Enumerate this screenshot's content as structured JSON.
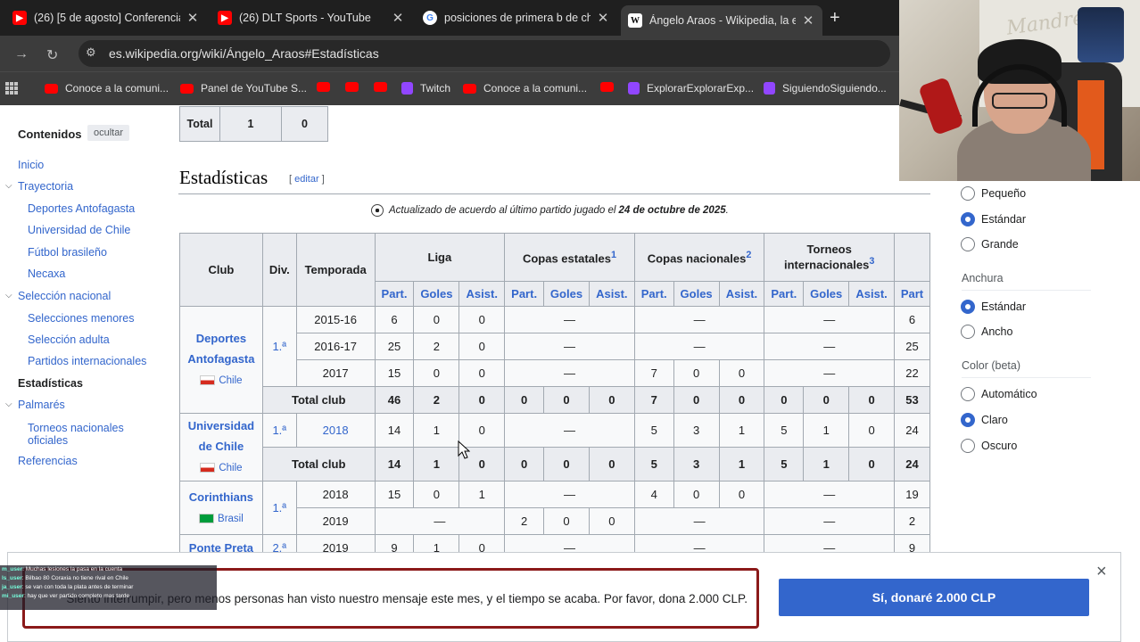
{
  "browser": {
    "tabs": [
      {
        "title": "(26) [5 de agosto] Conferencia",
        "icon": "youtube-icon"
      },
      {
        "title": "(26) DLT Sports - YouTube",
        "icon": "youtube-icon"
      },
      {
        "title": "posiciones de primera b de chi",
        "icon": "google-icon"
      },
      {
        "title": "Ángelo Araos - Wikipedia, la en",
        "icon": "wikipedia-icon"
      }
    ],
    "url": "es.wikipedia.org/wiki/Ángelo_Araos#Estadísticas",
    "bookmarks": [
      {
        "label": "Conoce a la comuni...",
        "icon": "youtube-icon"
      },
      {
        "label": "Panel de YouTube S...",
        "icon": "youtube-icon"
      },
      {
        "label": "",
        "icon": "youtube-icon"
      },
      {
        "label": "",
        "icon": "youtube-icon"
      },
      {
        "label": "",
        "icon": "youtube-icon"
      },
      {
        "label": "Twitch",
        "icon": "twitch-icon"
      },
      {
        "label": "Conoce a la comuni...",
        "icon": "twitch-icon"
      },
      {
        "label": "",
        "icon": "youtube-icon"
      },
      {
        "label": "ExplorarExplorarExp...",
        "icon": "twitch-icon"
      },
      {
        "label": "SiguiendoSiguiendo...",
        "icon": "twitch-icon"
      }
    ]
  },
  "toc": {
    "heading": "Contenidos",
    "hide_label": "ocultar",
    "items": [
      "Inicio",
      "Trayectoria",
      "Deportes Antofagasta",
      "Universidad de Chile",
      "Fútbol brasileño",
      "Necaxa",
      "Selección nacional",
      "Selecciones menores",
      "Selección adulta",
      "Partidos internacionales",
      "Estadísticas",
      "Palmarés",
      "Torneos nacionales oficiales",
      "Referencias"
    ]
  },
  "prev_table": {
    "label": "Total",
    "v1": "1",
    "v2": "0"
  },
  "section": {
    "title": "Estadísticas",
    "edit": "editar"
  },
  "updated": {
    "text": "Actualizado de acuerdo al último partido jugado el ",
    "date": "24 de octubre de 2025",
    "end": "."
  },
  "stats": {
    "headers": {
      "club": "Club",
      "div": "Div.",
      "season": "Temporada",
      "league": "Liga",
      "state_cups": "Copas estatales",
      "state_cups_note": "1",
      "national_cups": "Copas nacionales",
      "national_cups_note": "2",
      "intl": "Torneos internacionales",
      "intl_note": "3",
      "part": "Part.",
      "goals": "Goles",
      "assists": "Asist.",
      "part_cut": "Part"
    },
    "dash": "—",
    "total_club": "Total club",
    "clubs": [
      {
        "name": "Deportes Antofagasta",
        "country": "Chile",
        "div": "1.ª",
        "rows": [
          {
            "season": "2015-16",
            "lp": "6",
            "lg": "0",
            "la": "0",
            "np": "",
            "ng": "",
            "na": "",
            "last": "6"
          },
          {
            "season": "2016-17",
            "lp": "25",
            "lg": "2",
            "la": "0",
            "np": "",
            "ng": "",
            "na": "",
            "last": "25"
          },
          {
            "season": "2017",
            "lp": "15",
            "lg": "0",
            "la": "0",
            "np": "7",
            "ng": "0",
            "na": "0",
            "last": "22"
          }
        ],
        "total": [
          "46",
          "2",
          "0",
          "0",
          "0",
          "0",
          "7",
          "0",
          "0",
          "0",
          "0",
          "0",
          "53"
        ]
      },
      {
        "name": "Universidad de Chile",
        "country": "Chile",
        "div": "1.ª",
        "rows": [
          {
            "season": "2018",
            "lp": "14",
            "lg": "1",
            "la": "0",
            "np": "5",
            "ng": "3",
            "na": "1",
            "ip": "5",
            "ig": "1",
            "ia": "0",
            "last": "24"
          }
        ],
        "total": [
          "14",
          "1",
          "0",
          "0",
          "0",
          "0",
          "5",
          "3",
          "1",
          "5",
          "1",
          "0",
          "24"
        ]
      },
      {
        "name": "Corinthians",
        "country": "Brasil",
        "div": "1.ª",
        "rows": [
          {
            "season": "2018",
            "lp": "15",
            "lg": "0",
            "la": "1",
            "np": "4",
            "ng": "0",
            "na": "0",
            "last": "19"
          },
          {
            "season": "2019",
            "sp": "2",
            "sg": "0",
            "sa": "0",
            "last": "2"
          }
        ]
      },
      {
        "name": "Ponte Preta",
        "div": "2.ª",
        "rows": [
          {
            "season": "2019",
            "lp": "9",
            "lg": "1",
            "la": "0",
            "last": "9"
          }
        ]
      }
    ]
  },
  "appearance": {
    "text_options": [
      "Pequeño",
      "Estándar",
      "Grande"
    ],
    "width_heading": "Anchura",
    "width_options": [
      "Estándar",
      "Ancho"
    ],
    "color_heading": "Color (beta)",
    "color_options": [
      "Automático",
      "Claro",
      "Oscuro"
    ]
  },
  "webcam": {
    "logo": "Mandreva"
  },
  "donate": {
    "message": "Siento interrumpir, pero menos personas han visto nuestro mensaje este mes, y el tiempo se acaba. Por favor, dona 2.000 CLP.",
    "button": "Sí, donaré 2.000 CLP",
    "close": "×"
  },
  "chat": [
    {
      "user": "m_user",
      "text": "Muchas lesiones la pasa en la cuenta"
    },
    {
      "user": "ls_user",
      "text": "Bilbao 80 Coraxia no tiene rival en Chile"
    },
    {
      "user": "ja_user",
      "text": "se van con toda la plata antes de terminar"
    },
    {
      "user": "mi_user",
      "text": "hay que ver partido completo mas tarde"
    }
  ]
}
